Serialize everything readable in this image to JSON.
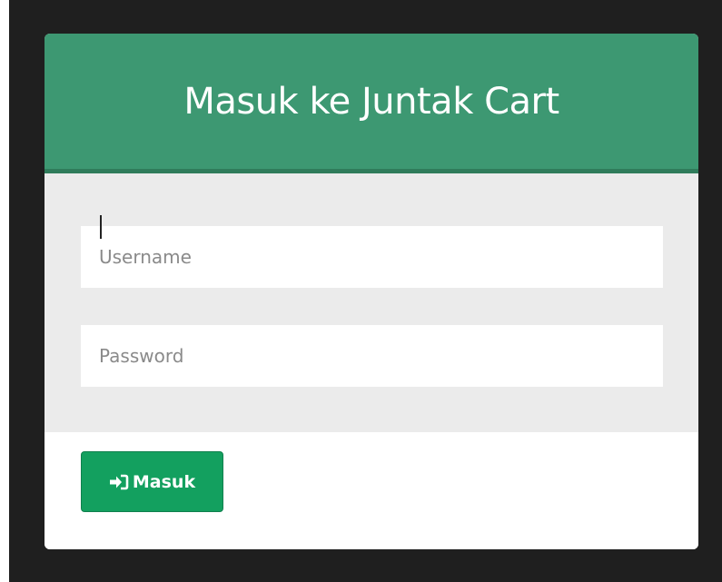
{
  "login": {
    "title": "Masuk ke Juntak Cart",
    "username_placeholder": "Username",
    "username_value": "",
    "password_placeholder": "Password",
    "password_value": "",
    "submit_label": "Masuk",
    "submit_icon": "sign-in-icon"
  },
  "colors": {
    "header": "#3d9872",
    "body": "#ebebeb",
    "button": "#13a05f",
    "background": "#1f1f1f"
  }
}
